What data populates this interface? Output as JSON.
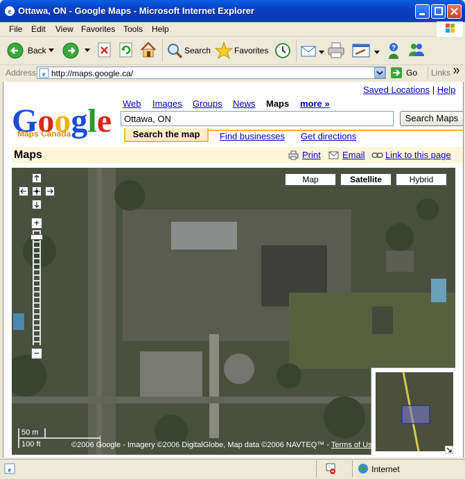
{
  "window": {
    "title": "Ottawa, ON - Google Maps - Microsoft Internet Explorer"
  },
  "menu": {
    "items": [
      "File",
      "Edit",
      "View",
      "Favorites",
      "Tools",
      "Help"
    ]
  },
  "toolbar": {
    "back_label": "Back",
    "search_label": "Search",
    "favorites_label": "Favorites"
  },
  "address": {
    "label": "Address",
    "url": "http://maps.google.ca/",
    "go_label": "Go",
    "links_label": "Links"
  },
  "page": {
    "top_links": {
      "saved": "Saved Locations",
      "sep": "|",
      "help": "Help"
    },
    "logo": {
      "text": "Google",
      "sub": "Maps Canada"
    },
    "nav": [
      "Web",
      "Images",
      "Groups",
      "News",
      "Maps",
      "more »"
    ],
    "search": {
      "value": "Ottawa, ON",
      "button": "Search Maps"
    },
    "tabs": {
      "search_map": "Search the map",
      "find_businesses": "Find businesses",
      "get_directions": "Get directions"
    },
    "maps_header": {
      "title": "Maps",
      "print": "Print",
      "email": "Email",
      "link": "Link to this page"
    },
    "map": {
      "types": [
        "Map",
        "Satellite",
        "Hybrid"
      ],
      "selected_type": "Satellite",
      "scale_m": "50 m",
      "scale_ft": "100 ft",
      "copyright": "©2006 Google - Imagery ©2006 DigitalGlobe, Map data ©2006 NAVTEQ™ -",
      "terms": "Terms of Use",
      "zoom_in": "+",
      "zoom_out": "−"
    }
  },
  "status": {
    "zone": "Internet"
  },
  "colors": {
    "titlebar": "#0a3fc4",
    "tab_border": "#f5b833",
    "maps_bar": "#fff5d9",
    "link": "#0000cc"
  }
}
